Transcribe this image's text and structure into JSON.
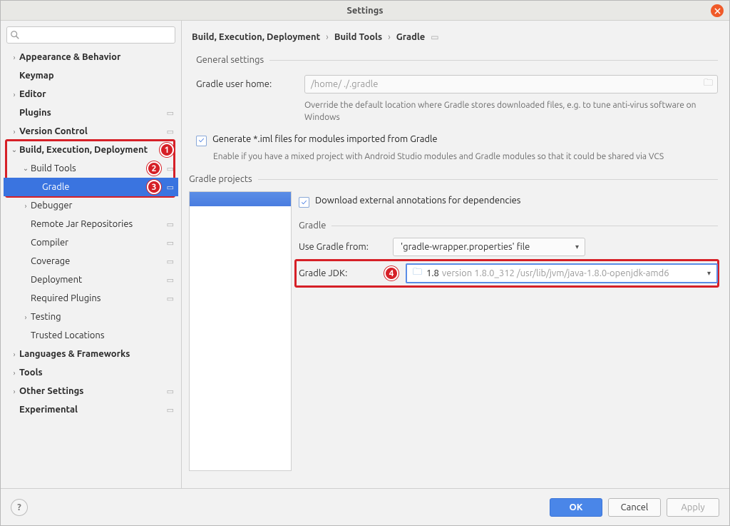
{
  "window_title": "Settings",
  "search_placeholder": "",
  "breadcrumb": [
    "Build, Execution, Deployment",
    "Build Tools",
    "Gradle"
  ],
  "sidebar": [
    {
      "label": "Appearance & Behavior",
      "depth": 0,
      "expandable": true,
      "expanded": false,
      "bold": true
    },
    {
      "label": "Keymap",
      "depth": 0,
      "expandable": false,
      "bold": true
    },
    {
      "label": "Editor",
      "depth": 0,
      "expandable": true,
      "expanded": false,
      "bold": true
    },
    {
      "label": "Plugins",
      "depth": 0,
      "expandable": false,
      "bold": true,
      "proj": true
    },
    {
      "label": "Version Control",
      "depth": 0,
      "expandable": true,
      "expanded": false,
      "bold": true,
      "proj": true
    },
    {
      "label": "Build, Execution, Deployment",
      "depth": 0,
      "expandable": true,
      "expanded": true,
      "bold": true,
      "callout": 1
    },
    {
      "label": "Build Tools",
      "depth": 1,
      "expandable": true,
      "expanded": true,
      "proj": true,
      "callout": 2
    },
    {
      "label": "Gradle",
      "depth": 2,
      "expandable": false,
      "selected": true,
      "proj": true,
      "callout": 3
    },
    {
      "label": "Debugger",
      "depth": 1,
      "expandable": true,
      "expanded": false
    },
    {
      "label": "Remote Jar Repositories",
      "depth": 1,
      "expandable": false,
      "proj": true
    },
    {
      "label": "Compiler",
      "depth": 1,
      "expandable": false,
      "proj": true
    },
    {
      "label": "Coverage",
      "depth": 1,
      "expandable": false,
      "proj": true
    },
    {
      "label": "Deployment",
      "depth": 1,
      "expandable": false,
      "proj": true
    },
    {
      "label": "Required Plugins",
      "depth": 1,
      "expandable": false,
      "proj": true
    },
    {
      "label": "Testing",
      "depth": 1,
      "expandable": true,
      "expanded": false
    },
    {
      "label": "Trusted Locations",
      "depth": 1,
      "expandable": false
    },
    {
      "label": "Languages & Frameworks",
      "depth": 0,
      "expandable": true,
      "expanded": false,
      "bold": true
    },
    {
      "label": "Tools",
      "depth": 0,
      "expandable": true,
      "expanded": false,
      "bold": true
    },
    {
      "label": "Other Settings",
      "depth": 0,
      "expandable": true,
      "expanded": false,
      "bold": true,
      "proj": true
    },
    {
      "label": "Experimental",
      "depth": 0,
      "expandable": false,
      "bold": true,
      "proj": true
    }
  ],
  "general_section": "General settings",
  "gradle_user_home_label": "Gradle user home:",
  "gradle_user_home_value": "/home/            ./.gradle",
  "gradle_user_home_hint": "Override the default location where Gradle stores downloaded files, e.g. to tune anti-virus software on Windows",
  "iml_checkbox_label": "Generate *.iml files for modules imported from Gradle",
  "iml_hint": "Enable if you have a mixed project with Android Studio modules and Gradle modules so that it could be shared via VCS",
  "projects_section": "Gradle projects",
  "download_annotations_label": "Download external annotations for dependencies",
  "gradle_sub_section": "Gradle",
  "use_gradle_from_label": "Use Gradle from:",
  "use_gradle_from_value": "'gradle-wrapper.properties' file",
  "gradle_jdk_label": "Gradle JDK:",
  "jdk_version": "1.8",
  "jdk_detail": "version 1.8.0_312 /usr/lib/jvm/java-1.8.0-openjdk-amd6",
  "jdk_callout": 4,
  "buttons": {
    "ok": "OK",
    "cancel": "Cancel",
    "apply": "Apply"
  }
}
